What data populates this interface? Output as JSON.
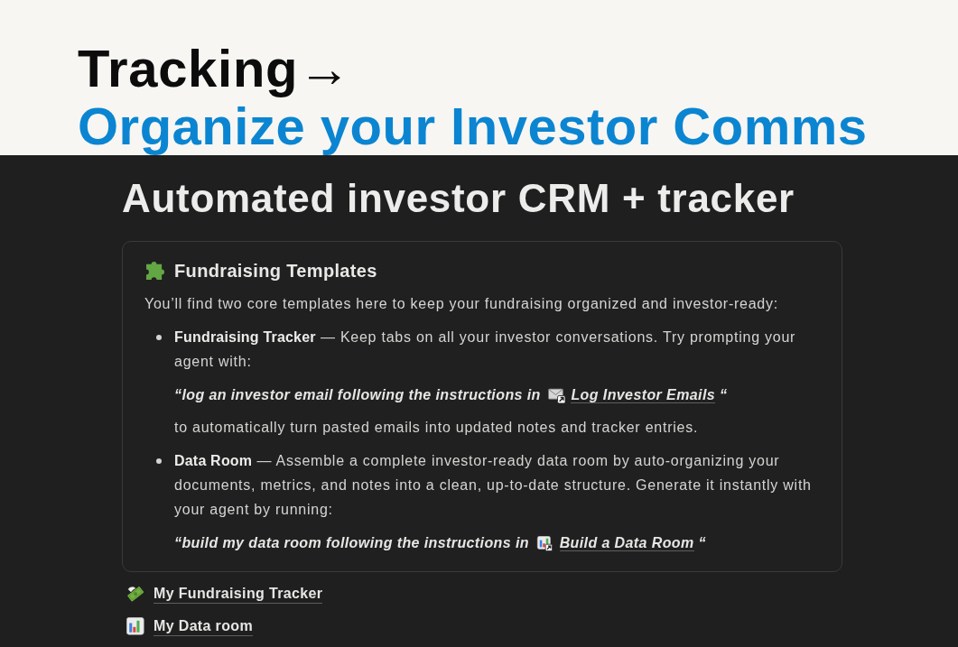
{
  "header": {
    "title": "Tracking→",
    "subtitle": "Organize your Investor Comms"
  },
  "page": {
    "title": "Automated investor CRM + tracker",
    "callout": {
      "title": "Fundraising Templates",
      "intro": "You’ll find two core templates here to keep your fundraising organized and investor-ready:",
      "items": [
        {
          "text": "**Fundraising Tracker** — Keep tabs on all your investor conversations. Try prompting your agent with:",
          "prompt": {
            "kind": "email",
            "before": "“log an investor email following the instructions in",
            "link": "Log Investor Emails",
            "after": "“"
          },
          "note": "to automatically turn pasted emails into updated notes and tracker entries."
        },
        {
          "text": "**Data Room** — Assemble a complete investor-ready data room by auto-organizing your documents, metrics, and notes into a clean, up-to-date structure. Generate it instantly with your agent by running:",
          "prompt": {
            "kind": "dataroom",
            "before": "“build my data room following the instructions in",
            "link": "Build a Data Room",
            "after": "“"
          }
        }
      ]
    },
    "links": [
      {
        "kind": "tracker",
        "label": "My Fundraising Tracker"
      },
      {
        "kind": "dataroom",
        "label": "My Data room"
      }
    ]
  }
}
